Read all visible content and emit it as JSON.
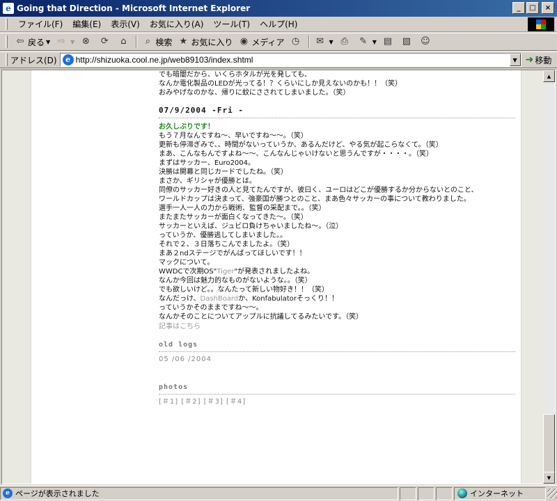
{
  "window": {
    "title": "Going that Direction - Microsoft Internet Explorer",
    "buttons": {
      "minimize": "_",
      "maximize": "□",
      "close": "×"
    }
  },
  "menu": [
    "ファイル(F)",
    "編集(E)",
    "表示(V)",
    "お気に入り(A)",
    "ツール(T)",
    "ヘルプ(H)"
  ],
  "toolbar": {
    "back": "戻る",
    "search": "検索",
    "favorites": "お気に入り",
    "media": "メディア"
  },
  "address": {
    "label": "アドレス(D)",
    "url": "http://shizuoka.cool.ne.jp/web89103/index.shtml",
    "go": "移動"
  },
  "content": {
    "top_lines": [
      "でも暗闇だから、いくらホタルが光を発しても、",
      "なんか電化製品のLEDが光ってる！？くらいにしか見えないのかも！！（笑）",
      "おみやげなのかな、帰りに蚊にさされてしまいました。（笑）"
    ],
    "date_heading": "07/9/2004 -Fri -",
    "entry_title": "お久しぶりです！",
    "entry_lines": [
      "もう７月なんですね～、早いですね～～。（笑）",
      "更新も停滞ぎみで、、時間がないっていうか、あるんだけど、やる気が起こらなくて。（笑）",
      "まあ、こんなもんですよね～～、こんなんじゃいけないと思うんですが・・・・。（笑）",
      "まずはサッカー、Euro2004。",
      "決勝は開幕と同じカードでしたね。（笑）",
      "まさか、ギリシャが優勝とは。",
      "同僚のサッカー好きの人と見てたんですが、彼曰く、ユーロはどこが優勝するか分からないとのこと、",
      "ワールドカップは決まって、強豪国が勝つとのこと、まあ色々サッカーの事について教わりました。",
      "選手一人一人の力から戦術、監督の采配まで。。（笑）",
      "またまたサッカーが面白くなってきた～。（笑）",
      "サッカーといえば、ジュビロ負けちゃいましたね～。（泣）",
      "っていうか、優勝逃してしまいました。。",
      "それで２、３日落ちこんでましたよ。（笑）",
      "まあ２ndステージでがんばってほしいです！！",
      "マックについて。"
    ],
    "wwdc_prefix": "WWDCで次期OS\"",
    "wwdc_link": "Tiger",
    "wwdc_suffix": "\"が発表されましたよね。",
    "entry_lines_2": [
      "なんか今回は魅力的なものがないような。。（笑）",
      "でも欲しいけど。。なんたって新しい物好き！！（笑）"
    ],
    "dash_prefix": "なんだっけ、",
    "dash_link": "DashBoard",
    "dash_suffix": "か、Konfabulatorそっくり！！",
    "entry_lines_3": [
      "っていうかそのままですね～～。",
      "なんかそのことについてアップルに抗議してるみたいです。（笑）"
    ],
    "more_link": "記事はこちら",
    "old_logs": {
      "heading": "old logs",
      "items": "05 /06 /2004"
    },
    "photos": {
      "heading": "photos",
      "items": "[＃1] [＃2] [＃3] [＃4]"
    }
  },
  "status": {
    "text": "ページが表示されました",
    "zone": "インターネット"
  }
}
